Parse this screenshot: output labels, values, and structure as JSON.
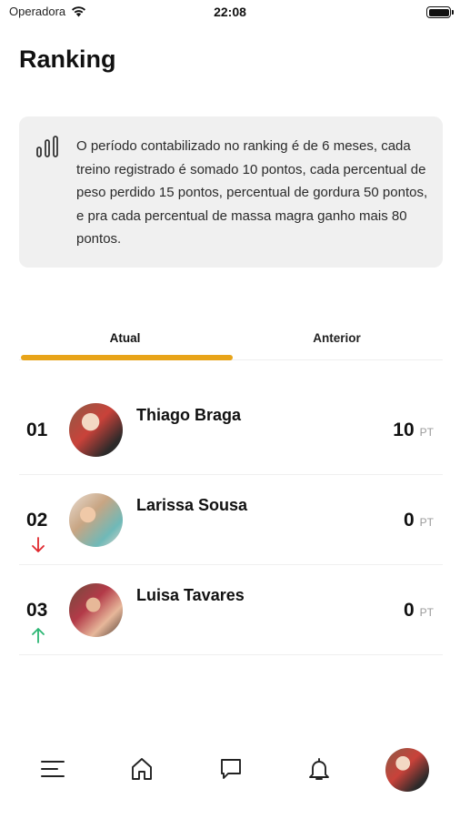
{
  "status_bar": {
    "carrier": "Operadora",
    "time": "22:08"
  },
  "page": {
    "title": "Ranking"
  },
  "info": {
    "icon": "bar-chart-icon",
    "text": "O período contabilizado no ranking é de 6 meses, cada treino registrado é somado 10 pontos, cada percentual de peso perdido 15 pontos, percentual de gordura 50 pontos, e pra cada percentual de massa magra ganho mais 80 pontos."
  },
  "tabs": [
    {
      "label": "Atual",
      "active": true
    },
    {
      "label": "Anterior",
      "active": false
    }
  ],
  "colors": {
    "accent": "#e8a419",
    "trend_down": "#e0282e",
    "trend_up": "#2bb673"
  },
  "ranking": [
    {
      "position": "01",
      "name": "Thiago Braga",
      "points": "10",
      "unit": "PT",
      "trend": "none"
    },
    {
      "position": "02",
      "name": "Larissa Sousa",
      "points": "0",
      "unit": "PT",
      "trend": "down"
    },
    {
      "position": "03",
      "name": "Luisa Tavares",
      "points": "0",
      "unit": "PT",
      "trend": "up"
    }
  ],
  "bottom_nav": [
    {
      "icon": "menu-icon"
    },
    {
      "icon": "home-icon"
    },
    {
      "icon": "chat-icon"
    },
    {
      "icon": "bell-icon"
    },
    {
      "icon": "profile-avatar"
    }
  ]
}
